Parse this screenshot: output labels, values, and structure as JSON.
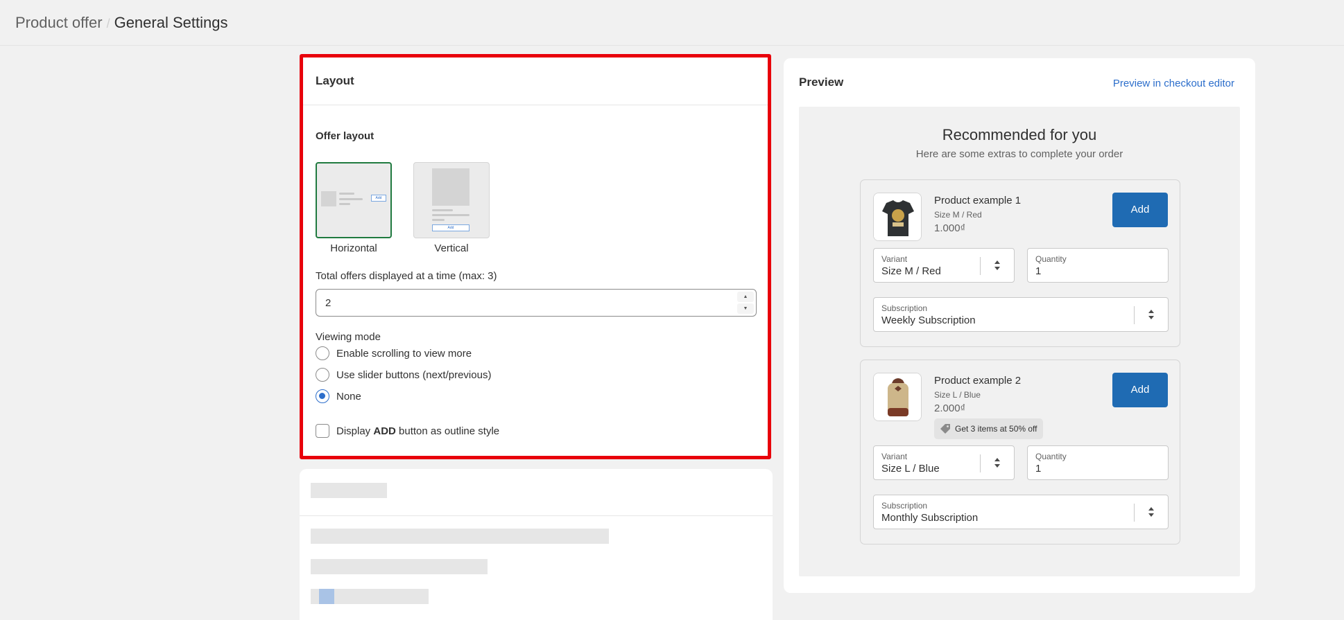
{
  "breadcrumb": {
    "root": "Product offer",
    "separator": "/",
    "current": "General Settings"
  },
  "layout_card": {
    "title": "Layout",
    "offer_layout_label": "Offer layout",
    "options": [
      {
        "label": "Horizontal",
        "selected": true,
        "mini_button": "Add"
      },
      {
        "label": "Vertical",
        "selected": false,
        "mini_button": "Add"
      }
    ],
    "total_offers_label": "Total offers displayed at a time (max: 3)",
    "total_offers_value": "2",
    "viewing_mode_label": "Viewing mode",
    "viewing_modes": [
      {
        "label": "Enable scrolling to view more",
        "checked": false
      },
      {
        "label": "Use slider buttons (next/previous)",
        "checked": false
      },
      {
        "label": "None",
        "checked": true
      }
    ],
    "outline_checkbox": {
      "prefix": "Display ",
      "bold": "ADD",
      "suffix": " button as outline style",
      "checked": false
    },
    "highlight_color": "#e8000b"
  },
  "preview": {
    "title": "Preview",
    "link": "Preview in checkout editor",
    "heading": "Recommended for you",
    "subheading": "Here are some extras to complete your order",
    "offers": [
      {
        "name": "Product example 1",
        "variant_text": "Size M / Red",
        "price": "1.000₫",
        "add_label": "Add",
        "variant_label": "Variant",
        "variant_value": "Size M / Red",
        "quantity_label": "Quantity",
        "quantity_value": "1",
        "subscription_label": "Subscription",
        "subscription_value": "Weekly Subscription",
        "thumb_icon": "tshirt-icon"
      },
      {
        "name": "Product example 2",
        "variant_text": "Size L / Blue",
        "price": "2.000₫",
        "add_label": "Add",
        "discount": "Get 3 items at 50% off",
        "variant_label": "Variant",
        "variant_value": "Size L / Blue",
        "quantity_label": "Quantity",
        "quantity_value": "1",
        "subscription_label": "Subscription",
        "subscription_value": "Monthly Subscription",
        "thumb_icon": "backpack-icon"
      }
    ],
    "accent_color": "#1f6bb3",
    "link_color": "#2c6ecb"
  }
}
